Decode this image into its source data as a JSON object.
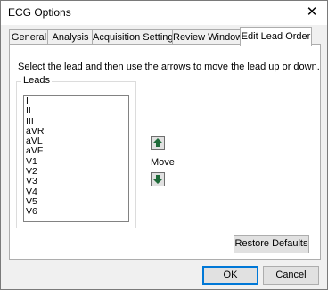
{
  "window": {
    "title": "ECG Options",
    "close_glyph": "✕"
  },
  "tabs": [
    {
      "label": "General"
    },
    {
      "label": "Analysis"
    },
    {
      "label": "Acquisition Settings"
    },
    {
      "label": "Review Window"
    },
    {
      "label": "Edit Lead Order",
      "selected": true
    }
  ],
  "panel": {
    "instruction": "Select the lead and then use the arrows to move the lead up or down.",
    "leads_group_label": "Leads",
    "leads": [
      "I",
      "II",
      "III",
      "aVR",
      "aVL",
      "aVF",
      "V1",
      "V2",
      "V3",
      "V4",
      "V5",
      "V6"
    ],
    "move_label": "Move",
    "move_up_icon": "arrow-up-icon",
    "move_down_icon": "arrow-down-icon",
    "restore_defaults_label": "Restore Defaults"
  },
  "footer": {
    "ok_label": "OK",
    "cancel_label": "Cancel"
  },
  "colors": {
    "arrow_fill": "#1f6b3a",
    "focus_border": "#0078d7"
  }
}
